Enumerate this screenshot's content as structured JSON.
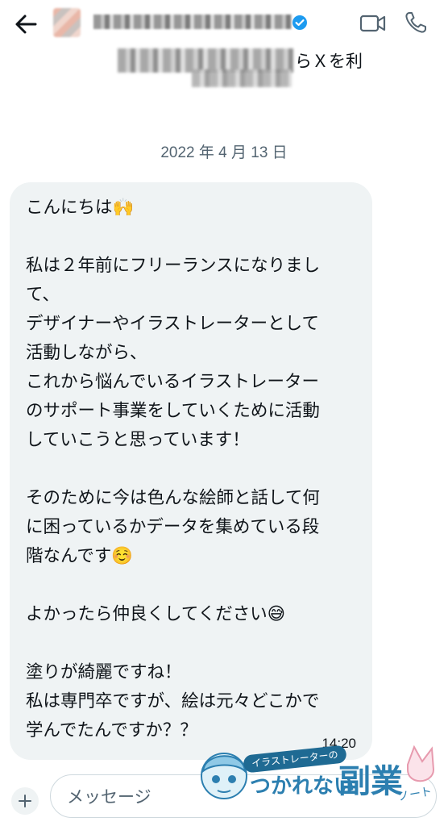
{
  "header": {
    "back_icon": "arrow-left-icon",
    "verified_icon": "verified-badge-icon",
    "verified_color": "#1d9bf0",
    "video_icon": "video-camera-icon",
    "phone_icon": "phone-icon",
    "subtitle_visible_text": "らＸを利"
  },
  "conversation": {
    "date": "2022 年 4 月 13 日",
    "message": {
      "text": "こんにちは🙌\n\n私は２年前にフリーランスになりまし\nて、\nデザイナーやイラストレーターとして\n活動しながら、\nこれから悩んでいるイラストレーター\nのサポート事業をしていくために活動\nしていこうと思っています！\n\nそのために今は色んな絵師と話して何\nに困っているかデータを集めている段\n階なんです☺️\n\nよかったら仲良くしてください😅\n\n塗りが綺麗ですね！\n私は専門卒ですが、絵は元々どこかで\n学んでたんですか？？",
      "time": "14:20",
      "bubble_color": "#eff3f4"
    }
  },
  "composer": {
    "add_icon": "plus-icon",
    "placeholder": "メッセージ"
  },
  "watermark": {
    "pill_text": "イラストレーターの",
    "main_text": "つかれない",
    "big_text": "副業",
    "note_text": "ノート"
  }
}
